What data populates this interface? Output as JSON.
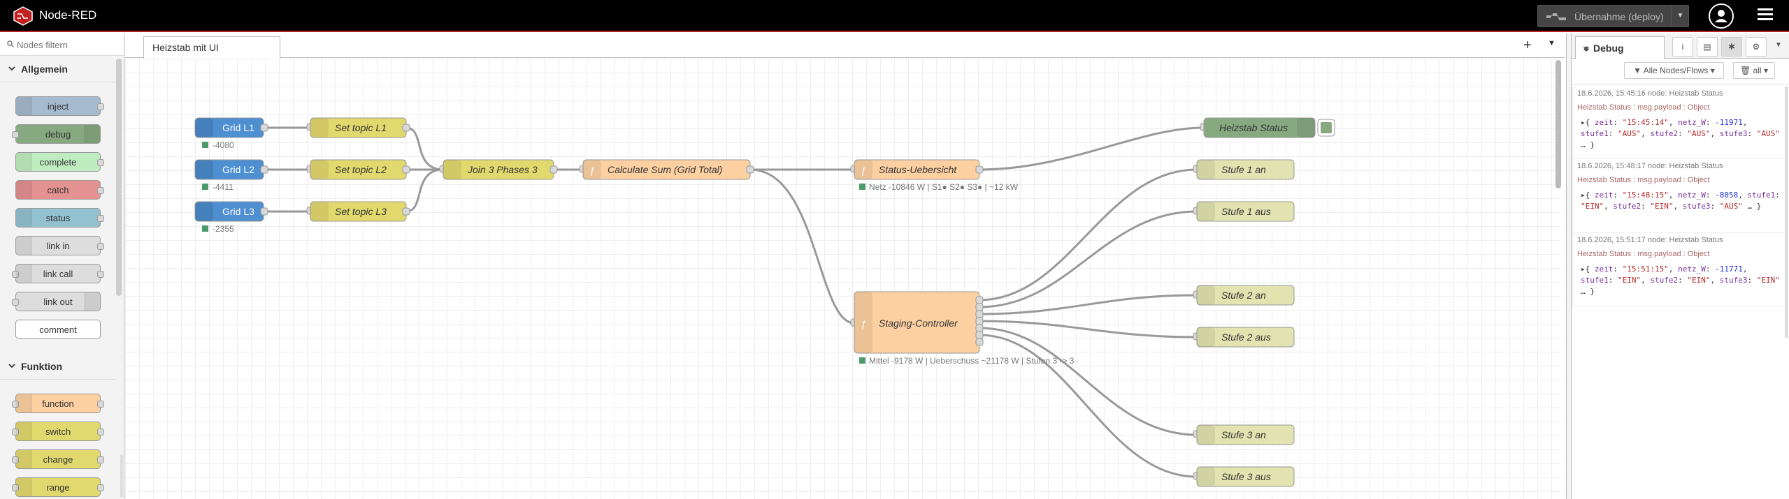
{
  "app": {
    "title": "Node-RED"
  },
  "header": {
    "deploy_label": "Übernahme (deploy)"
  },
  "palette": {
    "search_placeholder": "Nodes filtern",
    "categories": [
      {
        "label": "Allgemein",
        "nodes": [
          "inject",
          "debug",
          "complete",
          "catch",
          "status",
          "link in",
          "link call",
          "link out",
          "comment"
        ]
      },
      {
        "label": "Funktion",
        "nodes": [
          "function",
          "switch",
          "change",
          "range"
        ]
      }
    ]
  },
  "workspace": {
    "tab_label": "Heizstab mit UI",
    "nodes": {
      "grid_l1": {
        "label": "Grid L1",
        "status": "-4080"
      },
      "grid_l2": {
        "label": "Grid L2",
        "status": "-4411"
      },
      "grid_l3": {
        "label": "Grid L3",
        "status": "-2355"
      },
      "set_l1": {
        "label": "Set topic L1"
      },
      "set_l2": {
        "label": "Set topic L2"
      },
      "set_l3": {
        "label": "Set topic L3"
      },
      "join": {
        "label": "Join 3 Phases 3"
      },
      "calc_sum": {
        "label": "Calculate Sum (Grid Total)"
      },
      "status_ueb": {
        "label": "Status-Uebersicht",
        "status": "Netz -10846 W | S1● S2● S3● | ~12 kW"
      },
      "staging": {
        "label": "Staging-Controller",
        "status": "Mittel -9178 W | Ueberschuss ~21178 W | Stufen 3 -> 3"
      },
      "heizstab_status": {
        "label": "Heizstab Status"
      },
      "stufe1an": {
        "label": "Stufe 1 an"
      },
      "stufe1aus": {
        "label": "Stufe 1 aus"
      },
      "stufe2an": {
        "label": "Stufe 2 an"
      },
      "stufe2aus": {
        "label": "Stufe 2 aus"
      },
      "stufe3an": {
        "label": "Stufe 3 an"
      },
      "stufe3aus": {
        "label": "Stufe 3 aus"
      }
    }
  },
  "sidebar": {
    "tab_label": "Debug",
    "filter_label": "Alle Nodes/Flows",
    "clear_label": "all",
    "messages": [
      {
        "meta": "18.6.2026, 15:45:16   node: Heizstab Status",
        "topic": "Heizstab Status : msg.payload : Object",
        "payload": [
          [
            "zeit",
            "\"15:45:14\""
          ],
          [
            "netz_W",
            "-11971"
          ],
          [
            "stufe1",
            "\"AUS\""
          ],
          [
            "stufe2",
            "\"AUS\""
          ],
          [
            "stufe3",
            "\"AUS\""
          ]
        ]
      },
      {
        "meta": "18.6.2026, 15:48:17   node: Heizstab Status",
        "topic": "Heizstab Status : msg.payload : Object",
        "payload": [
          [
            "zeit",
            "\"15:48:15\""
          ],
          [
            "netz_W",
            "-8058"
          ],
          [
            "stufe1",
            "\"EIN\""
          ],
          [
            "stufe2",
            "\"EIN\""
          ],
          [
            "stufe3",
            "\"AUS\""
          ]
        ]
      },
      {
        "meta": "18.6.2026, 15:51:17   node: Heizstab Status",
        "topic": "Heizstab Status : msg.payload : Object",
        "payload": [
          [
            "zeit",
            "\"15:51:15\""
          ],
          [
            "netz_W",
            "-11771"
          ],
          [
            "stufe1",
            "\"EIN\""
          ],
          [
            "stufe2",
            "\"EIN\""
          ],
          [
            "stufe3",
            "\"EIN\""
          ]
        ]
      }
    ]
  },
  "colors": {
    "inject": "#a6bbcf",
    "debug": "#87a980",
    "complete": "#c0edc0",
    "catch": "#e49191",
    "status": "#94c1d0",
    "link": "#dddddd",
    "function": "#fdd0a2",
    "switch": "#e2d96e",
    "change": "#e2d96e",
    "mqtt": "#4d8fd1",
    "ui": "#e2e3b0"
  }
}
